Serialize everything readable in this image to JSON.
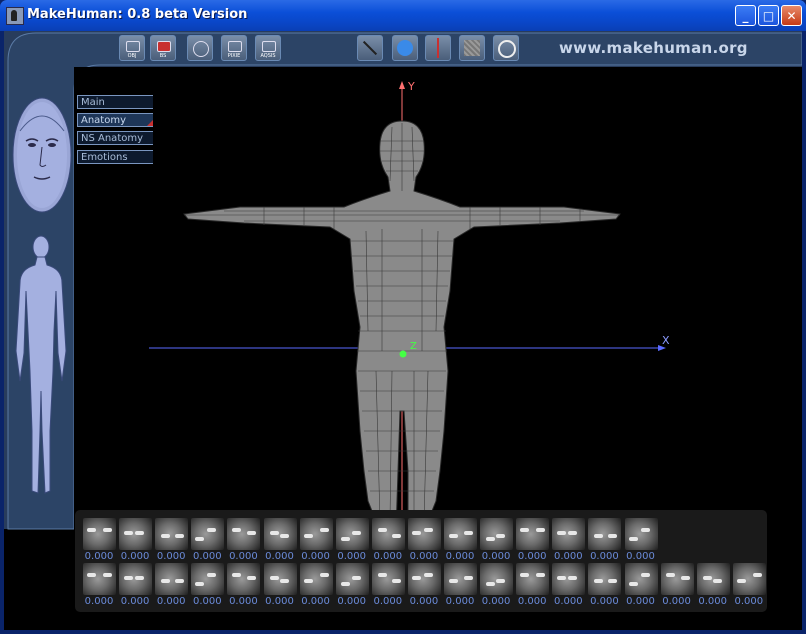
{
  "window": {
    "title": "MakeHuman: 0.8 beta Version",
    "controls": [
      "minimize",
      "maximize",
      "close"
    ]
  },
  "toolbar": {
    "left_tools": [
      {
        "name": "export-obj-button",
        "label": "OBJ"
      },
      {
        "name": "save-button",
        "label": "BS"
      },
      {
        "name": "reset-button",
        "label": ""
      },
      {
        "name": "render-pixie-button",
        "label": "PIXIE"
      },
      {
        "name": "render-aqsis-button",
        "label": "AQSIS"
      }
    ],
    "right_tools": [
      {
        "name": "wireframe-button",
        "label": ""
      },
      {
        "name": "smooth-button",
        "label": ""
      },
      {
        "name": "axes-button",
        "label": ""
      },
      {
        "name": "grid-button",
        "label": ""
      },
      {
        "name": "info-button",
        "label": ""
      }
    ],
    "website": "www.makehuman.org"
  },
  "menu_tabs": [
    {
      "label": "Main",
      "active": false
    },
    {
      "label": "Anatomy",
      "active": true
    },
    {
      "label": "NS Anatomy",
      "active": false
    },
    {
      "label": "Emotions",
      "active": false
    }
  ],
  "viewport": {
    "axis_y_label": "Y",
    "axis_x_label": "X",
    "axis_z_label": "Z"
  },
  "morph_targets": {
    "row1": [
      "0.000",
      "0.000",
      "0.000",
      "0.000",
      "0.000",
      "0.000",
      "0.000",
      "0.000",
      "0.000",
      "0.000",
      "0.000",
      "0.000",
      "0.000",
      "0.000",
      "0.000",
      "0.000"
    ],
    "row2": [
      "0.000",
      "0.000",
      "0.000",
      "0.000",
      "0.000",
      "0.000",
      "0.000",
      "0.000",
      "0.000",
      "0.000",
      "0.000",
      "0.000",
      "0.000",
      "0.000",
      "0.000",
      "0.000",
      "0.000",
      "0.000",
      "0.000"
    ]
  },
  "colors": {
    "title_blue": "#0b4fd8",
    "panel_blue": "#2c4466",
    "value_blue": "#6a8ad8",
    "axis_y": "#ff6060",
    "axis_x": "#5a6aff"
  }
}
